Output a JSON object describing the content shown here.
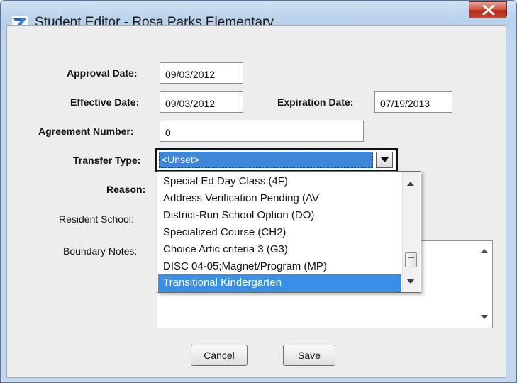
{
  "window": {
    "title": "Student Editor - Rosa Parks Elementary",
    "close_label": "X"
  },
  "form": {
    "approval_date": {
      "label": "Approval Date:",
      "value": "09/03/2012"
    },
    "effective_date": {
      "label": "Effective Date:",
      "value": "09/03/2012"
    },
    "expiration_date": {
      "label": "Expiration Date:",
      "value": "07/19/2013"
    },
    "agreement_number": {
      "label": "Agreement Number:",
      "value": "0"
    },
    "transfer_type": {
      "label": "Transfer Type:",
      "value": "<Unset>"
    },
    "reason": {
      "label": "Reason:"
    },
    "resident_school": {
      "label": "Resident School:"
    },
    "boundary_notes": {
      "label": "Boundary Notes:",
      "value": ""
    }
  },
  "dropdown": {
    "options": [
      "Special Ed Day Class (4F)",
      "Address Verification Pending (AV",
      "District-Run School Option (DO)",
      "Specialized Course (CH2)",
      "Choice Artic criteria 3 (G3)",
      "DISC 04-05;Magnet/Program (MP)",
      "Transitional Kindergarten"
    ],
    "selected_index": 6
  },
  "buttons": {
    "cancel": {
      "accesskey": "C",
      "rest": "ancel"
    },
    "save": {
      "accesskey": "S",
      "rest": "ave"
    }
  },
  "colors": {
    "selection": "#3a8ee6",
    "close_button": "#c44a34",
    "title_bar": "#b9d1ea"
  }
}
